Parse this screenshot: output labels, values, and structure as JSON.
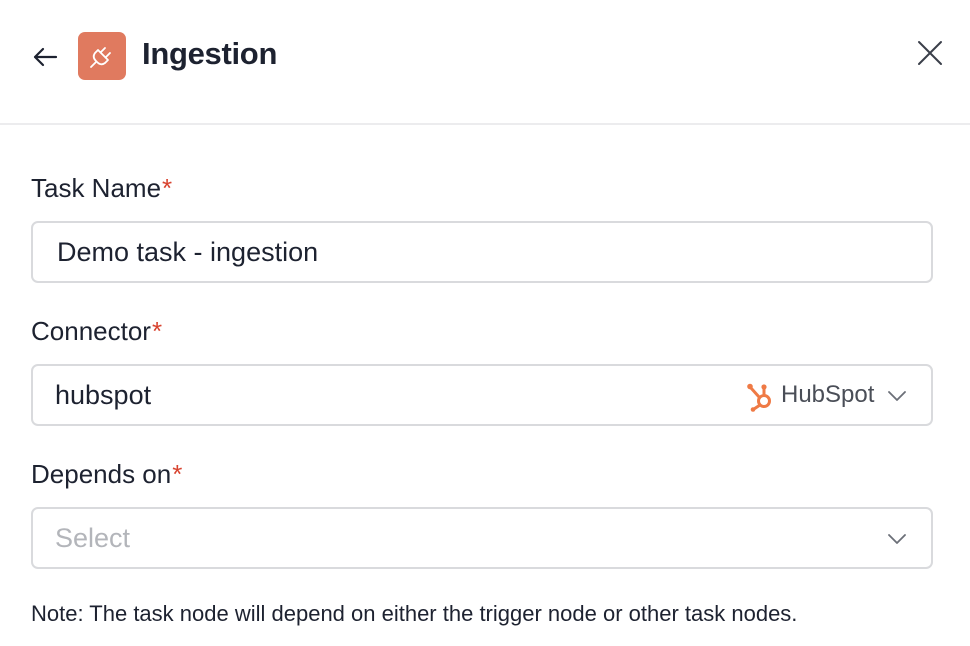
{
  "header": {
    "title": "Ingestion",
    "icon": "plug-icon",
    "icon_color": "#e07a5f"
  },
  "form": {
    "task_name": {
      "label": "Task Name",
      "required_mark": "*",
      "value": "Demo task - ingestion"
    },
    "connector": {
      "label": "Connector",
      "required_mark": "*",
      "value": "hubspot",
      "badge_text": "HubSpot",
      "badge_icon": "hubspot-logo",
      "badge_color": "#ef7a45"
    },
    "depends_on": {
      "label": "Depends on",
      "required_mark": "*",
      "placeholder": "Select"
    },
    "note": "Note: The task node will depend on either the trigger node or other task nodes."
  },
  "colors": {
    "required": "#d8432f",
    "border": "#d9dadd",
    "placeholder": "#b3b5ba"
  }
}
